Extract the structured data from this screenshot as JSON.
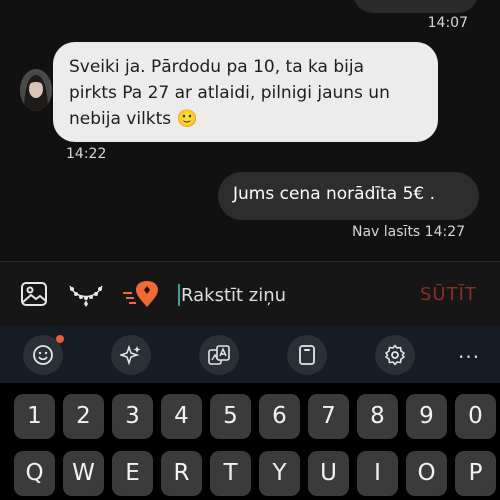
{
  "chat": {
    "previous_time": "14:07",
    "incoming": {
      "line1": "Sveiki ja. Pārdodu pa 10, ta ka bija",
      "line2": "pirkts Pa 27 ar atlaidi, pilnigi jauns un",
      "line3": "nebija vilkts 🙂",
      "time": "14:22"
    },
    "outgoing": {
      "text": "Jums cena norādīta 5€ .",
      "status": "Nav lasīts 14:27"
    }
  },
  "compose": {
    "placeholder": "Rakstīt ziņu",
    "send_label": "SŪTĪT"
  },
  "toolbar": {
    "more": "···",
    "icons": [
      "emoji-icon",
      "sparkle-icon",
      "translate-icon",
      "clipboard-icon",
      "settings-icon",
      "more-icon"
    ]
  },
  "keyboard": {
    "number_row": [
      "1",
      "2",
      "3",
      "4",
      "5",
      "6",
      "7",
      "8",
      "9",
      "0"
    ],
    "letter_row": [
      "Q",
      "W",
      "E",
      "R",
      "T",
      "Y",
      "U",
      "I",
      "O",
      "P"
    ]
  },
  "colors": {
    "background": "#111111",
    "incoming_bubble": "#ececec",
    "outgoing_bubble": "#2d2d2d",
    "send_label": "#8a2e28",
    "accent_orange": "#f26a2e",
    "keyboard_toolbar": "#151c24",
    "key": "#3b3b3b"
  }
}
